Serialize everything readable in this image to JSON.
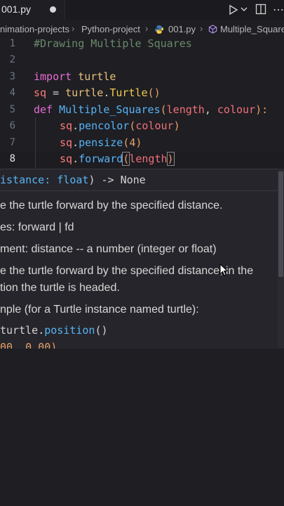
{
  "tab": {
    "filename": "001.py"
  },
  "breadcrumb": {
    "items": [
      "nimation-projects",
      "Python-project",
      "001.py",
      "Multiple_Square"
    ]
  },
  "code_lines": [
    {
      "num": "1",
      "text": "#Drawing Multiple Squares"
    },
    {
      "num": "2",
      "text": ""
    },
    {
      "num": "3",
      "kw": "import",
      "rest": " turtle"
    },
    {
      "num": "4",
      "a": "sq",
      "b": " = ",
      "c": "turtle",
      "d": ".",
      "e": "Turtle",
      "f": "()"
    },
    {
      "num": "5",
      "kw": "def",
      "fn": "Multiple_Squares",
      "p1": "length",
      "p2": "colour",
      "end": "):"
    },
    {
      "num": "6",
      "obj": "sq",
      "method": "pencolor",
      "arg": "colour"
    },
    {
      "num": "7",
      "obj": "sq",
      "method": "pensize",
      "arg": "4"
    },
    {
      "num": "8",
      "obj": "sq",
      "method": "forward",
      "arg": "length"
    }
  ],
  "hover": {
    "signature_param": "istance: float",
    "signature_rest": ") -> None",
    "doc1": "e the turtle forward by the specified distance.",
    "doc2": "es: forward | fd",
    "doc3": "ment: distance -- a number (integer or float)",
    "doc4a": "e the turtle forward by the specified distance, in the",
    "doc4b": "tion the turtle is headed.",
    "doc5": "nple (for a Turtle instance named turtle):",
    "ex_obj": "turtle",
    "ex_method": "position",
    "ex_end": "()",
    "ex_next": "00, 0.00)"
  },
  "colors": {
    "keyword": "#e86bd3",
    "function": "#58b4f5",
    "parameter": "#f07178",
    "comment": "#6a8a6a",
    "background": "#1e1e23"
  }
}
